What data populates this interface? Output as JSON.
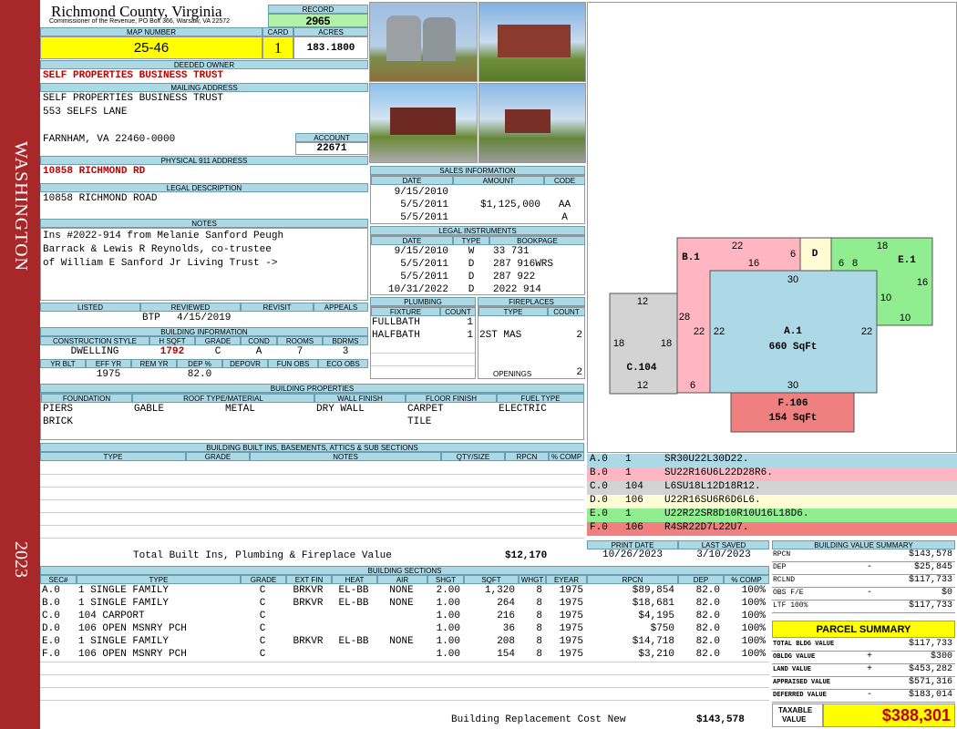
{
  "sidebar": {
    "county": "WASHINGTON",
    "year": "2023"
  },
  "header": {
    "county": "Richmond County, Virginia",
    "commissioner": "Commissioner of the Revenue, PO Box 366, Warsaw, VA 22572",
    "record_label": "RECORD",
    "record": "2965",
    "map_label": "MAP NUMBER",
    "map": "25-46",
    "card_label": "CARD",
    "card": "1",
    "acres_label": "ACRES",
    "acres": "183.1800"
  },
  "owner": {
    "label": "DEEDED OWNER",
    "name": "SELF PROPERTIES BUSINESS TRUST",
    "mail_label": "MAILING ADDRESS",
    "mail1": "SELF PROPERTIES BUSINESS TRUST",
    "mail2": "553 SELFS LANE",
    "mail3": "FARNHAM, VA 22460-0000",
    "account_label": "ACCOUNT",
    "account": "22671",
    "addr_label": "PHYSICAL 911 ADDRESS",
    "addr": "10858 RICHMOND RD",
    "legal_label": "LEGAL DESCRIPTION",
    "legal": "10858 RICHMOND ROAD",
    "notes_label": "NOTES",
    "notes": [
      "Ins #2022-914 from Melanie Sanford Peugh",
      "Barrack & Lewis R Reynolds, co-trustee",
      "of William E Sanford Jr Living Trust ->"
    ]
  },
  "review": {
    "h": [
      "LISTED",
      "REVIEWED",
      "REVISIT",
      "APPEALS"
    ],
    "reviewed_by": "BTP",
    "reviewed_date": "4/15/2019"
  },
  "bldg": {
    "label": "BUILDING INFORMATION",
    "h": [
      "CONSTRUCTION STYLE",
      "H SQFT",
      "GRADE",
      "COND",
      "ROOMS",
      "BDRMS"
    ],
    "v": [
      "DWELLING",
      "1792",
      "C",
      "A",
      "7",
      "3"
    ],
    "h2": [
      "YR BLT",
      "EFF YR",
      "REM YR",
      "DEP %",
      "DEPOVR",
      "FUN OBS",
      "ECO OBS"
    ],
    "v2": [
      "",
      "1975",
      "",
      "82.0",
      "",
      "",
      ""
    ]
  },
  "props": {
    "label": "BUILDING PROPERTIES",
    "h": [
      "FOUNDATION",
      "ROOF TYPE/MATERIAL",
      "WALL FINISH",
      "FLOOR FINISH",
      "FUEL TYPE"
    ],
    "foundation": [
      "PIERS",
      "BRICK"
    ],
    "roof": "GABLE",
    "roof_mat": "METAL",
    "wall": "DRY WALL",
    "floor": [
      "CARPET",
      "TILE"
    ],
    "fuel": "ELECTRIC"
  },
  "builtins": {
    "label": "BUILDING BUILT INS, BASEMENTS, ATTICS & SUB SECTIONS",
    "h": [
      "TYPE",
      "GRADE",
      "NOTES",
      "QTY/SIZE",
      "RPCN",
      "% COMP"
    ],
    "total_label": "Total Built Ins, Plumbing & Fireplace Value",
    "total": "$12,170"
  },
  "sales": {
    "label": "SALES INFORMATION",
    "h": [
      "DATE",
      "AMOUNT",
      "CODE"
    ],
    "rows": [
      [
        "9/15/2010",
        "",
        ""
      ],
      [
        "5/5/2011",
        "$1,125,000",
        "AA"
      ],
      [
        "5/5/2011",
        "",
        "A"
      ]
    ]
  },
  "instr": {
    "label": "LEGAL INSTRUMENTS",
    "h": [
      "DATE",
      "TYPE",
      "BOOKPAGE"
    ],
    "rows": [
      [
        "9/15/2010",
        "W",
        "33 731"
      ],
      [
        "5/5/2011",
        "D",
        "287 916WRS"
      ],
      [
        "5/5/2011",
        "D",
        "287 922"
      ],
      [
        "10/31/2022",
        "D",
        "2022 914"
      ]
    ]
  },
  "plumb": {
    "label": "PLUMBING",
    "h": [
      "FIXTURE",
      "COUNT"
    ],
    "rows": [
      [
        "FULLBATH",
        "1"
      ],
      [
        "HALFBATH",
        "1"
      ]
    ]
  },
  "fire": {
    "label": "FIREPLACES",
    "h": [
      "TYPE",
      "COUNT"
    ],
    "rows": [
      [
        "2ST MAS",
        "2"
      ]
    ],
    "openings_label": "OPENINGS",
    "openings": "2"
  },
  "sketch": {
    "sections": [
      {
        "id": "A.1",
        "area": "660 SqFt",
        "color": "#add8e6"
      },
      {
        "id": "B.1",
        "color": "#ffb6c1"
      },
      {
        "id": "C.104",
        "color": "#d3d3d3"
      },
      {
        "id": "D",
        "color": "#fffbd5"
      },
      {
        "id": "E.1",
        "color": "#90ee90"
      },
      {
        "id": "F.106",
        "area": "154 SqFt",
        "color": "#f08080"
      }
    ],
    "dims": [
      "22",
      "6",
      "18",
      "16",
      "6",
      "8",
      "16",
      "30",
      "12",
      "28",
      "10",
      "10",
      "18",
      "18",
      "22",
      "22",
      "22",
      "12",
      "6",
      "30"
    ],
    "codes": [
      [
        "A.0",
        "1",
        "SR30U22L30D22."
      ],
      [
        "B.0",
        "1",
        "SU22R16U6L22D28R6."
      ],
      [
        "C.0",
        "104",
        "L6SU18L12D18R12."
      ],
      [
        "D.0",
        "106",
        "U22R16SU6R6D6L6."
      ],
      [
        "E.0",
        "1",
        "U22R22SR8D10R10U16L18D6."
      ],
      [
        "F.0",
        "106",
        "R4SR22D7L22U7."
      ]
    ]
  },
  "dates": {
    "print_label": "PRINT DATE",
    "print": "10/26/2023",
    "saved_label": "LAST SAVED",
    "saved": "3/10/2023"
  },
  "bvs": {
    "label": "BUILDING VALUE SUMMARY",
    "rows": [
      [
        "RPCN",
        "",
        "$143,578"
      ],
      [
        "DEP",
        "-",
        "$25,845"
      ],
      [
        "RCLND",
        "",
        "$117,733"
      ],
      [
        "OBS F/E",
        "-",
        "$0"
      ],
      [
        "LTF 100%",
        "",
        "$117,733"
      ]
    ]
  },
  "sections": {
    "label": "BUILDING SECTIONS",
    "h": [
      "SEC#",
      "TYPE",
      "GRADE",
      "EXT FIN",
      "HEAT",
      "AIR",
      "SHGT",
      "SQFT",
      "WHGT",
      "EYEAR",
      "RPCN",
      "DEP",
      "% COMP"
    ],
    "rows": [
      [
        "A.0",
        "1 SINGLE FAMILY",
        "C",
        "BRKVR",
        "EL-BB",
        "NONE",
        "2.00",
        "1,320",
        "8",
        "1975",
        "$89,854",
        "82.0",
        "100%"
      ],
      [
        "B.0",
        "1 SINGLE FAMILY",
        "C",
        "BRKVR",
        "EL-BB",
        "NONE",
        "1.00",
        "264",
        "8",
        "1975",
        "$18,681",
        "82.0",
        "100%"
      ],
      [
        "C.0",
        "104 CARPORT",
        "C",
        "",
        "",
        "",
        "1.00",
        "216",
        "8",
        "1975",
        "$4,195",
        "82.0",
        "100%"
      ],
      [
        "D.0",
        "106 OPEN MSNRY PCH",
        "C",
        "",
        "",
        "",
        "1.00",
        "36",
        "8",
        "1975",
        "$750",
        "82.0",
        "100%"
      ],
      [
        "E.0",
        "1 SINGLE FAMILY",
        "C",
        "BRKVR",
        "EL-BB",
        "NONE",
        "1.00",
        "208",
        "8",
        "1975",
        "$14,718",
        "82.0",
        "100%"
      ],
      [
        "F.0",
        "106 OPEN MSNRY PCH",
        "C",
        "",
        "",
        "",
        "1.00",
        "154",
        "8",
        "1975",
        "$3,210",
        "82.0",
        "100%"
      ]
    ],
    "brcn_label": "Building Replacement Cost New",
    "brcn": "$143,578"
  },
  "parcel": {
    "label": "PARCEL SUMMARY",
    "rows": [
      [
        "TOTAL BLDG VALUE",
        "",
        "$117,733"
      ],
      [
        "OBLDG VALUE",
        "+",
        "$300"
      ],
      [
        "LAND VALUE",
        "+",
        "$453,282"
      ],
      [
        "APPRAISED VALUE",
        "",
        "$571,316"
      ],
      [
        "DEFERRED VALUE",
        "-",
        "$183,014"
      ]
    ],
    "taxable_label": [
      "TAXABLE",
      "VALUE"
    ],
    "taxable": "$388,301"
  }
}
